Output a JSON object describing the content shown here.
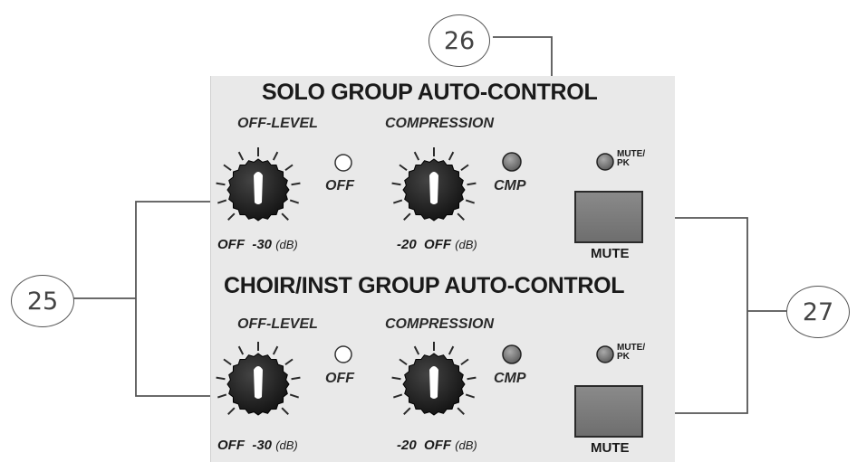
{
  "sections": [
    {
      "title": "SOLO GROUP AUTO-CONTROL",
      "off_level": {
        "label": "OFF-LEVEL",
        "scale_min": "OFF",
        "scale_max": "-30",
        "unit": "(dB)"
      },
      "off_led": {
        "label": "OFF"
      },
      "compression": {
        "label": "COMPRESSION",
        "scale_min": "-20",
        "scale_max": "OFF",
        "unit": "(dB)"
      },
      "cmp_led": {
        "label": "CMP"
      },
      "mute_led": {
        "label_line1": "MUTE/",
        "label_line2": "PK"
      },
      "mute_button": {
        "label": "MUTE"
      }
    },
    {
      "title": "CHOIR/INST GROUP AUTO-CONTROL",
      "off_level": {
        "label": "OFF-LEVEL",
        "scale_min": "OFF",
        "scale_max": "-30",
        "unit": "(dB)"
      },
      "off_led": {
        "label": "OFF"
      },
      "compression": {
        "label": "COMPRESSION",
        "scale_min": "-20",
        "scale_max": "OFF",
        "unit": "(dB)"
      },
      "cmp_led": {
        "label": "CMP"
      },
      "mute_led": {
        "label_line1": "MUTE/",
        "label_line2": "PK"
      },
      "mute_button": {
        "label": "MUTE"
      }
    }
  ],
  "callouts": {
    "off_level": "25",
    "compression": "26",
    "mute": "27"
  },
  "colors": {
    "panel": "#e9e9e9",
    "knob": "#1e1e1e",
    "led_off": "#ffffff",
    "led_on": "#7a7a7a",
    "leader": "#555555"
  }
}
